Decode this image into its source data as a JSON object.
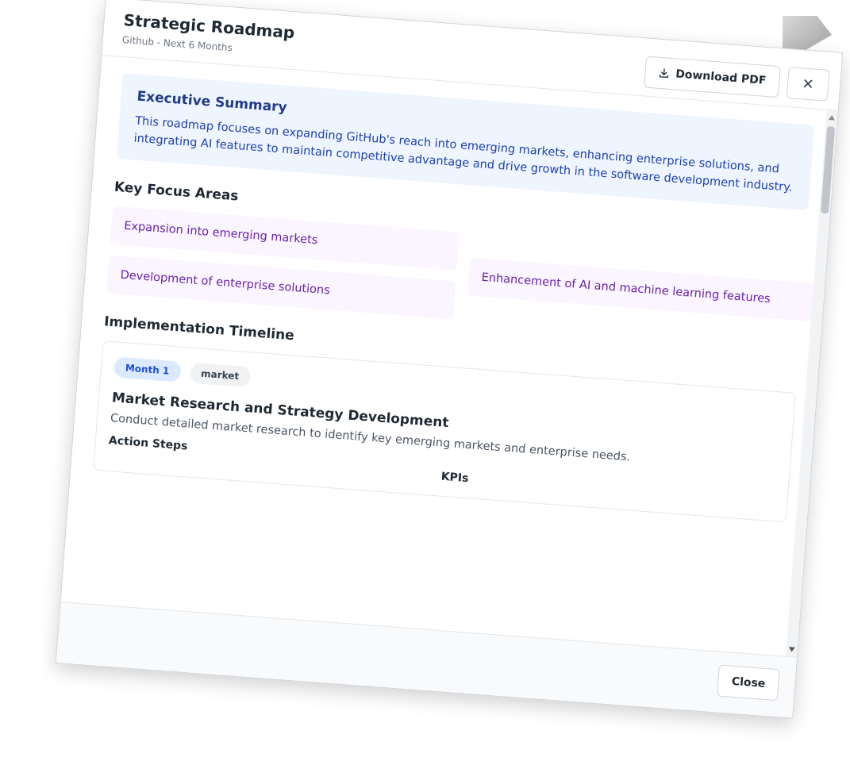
{
  "modal": {
    "title": "Strategic Roadmap",
    "subtitle": "Github - Next 6 Months",
    "download_label": "Download PDF",
    "download_icon": "download-icon",
    "close_icon_glyph": "✕",
    "footer_close_label": "Close"
  },
  "summary": {
    "title": "Executive Summary",
    "text": "This roadmap focuses on expanding GitHub's reach into emerging markets, enhancing enterprise solutions, and integrating AI features to maintain competitive advantage and drive growth in the software development industry."
  },
  "focus": {
    "title": "Key Focus Areas",
    "items": [
      "Expansion into emerging markets",
      "Enhancement of AI and machine learning features",
      "Development of enterprise solutions"
    ]
  },
  "timeline": {
    "title": "Implementation Timeline",
    "items": [
      {
        "month": "Month 1",
        "category": "market",
        "title": "Market Research and Strategy Development",
        "description": "Conduct detailed market research to identify key emerging markets and enterprise needs.",
        "action_steps_label": "Action Steps",
        "kpis_label": "KPIs"
      }
    ]
  },
  "colors": {
    "summary_bg": "#eef5fe",
    "summary_text": "#1e40af",
    "focus_bg": "#faf5ff",
    "focus_text": "#6b21a8",
    "month_pill_bg": "#dbeafe",
    "month_pill_text": "#1d4ed8"
  }
}
